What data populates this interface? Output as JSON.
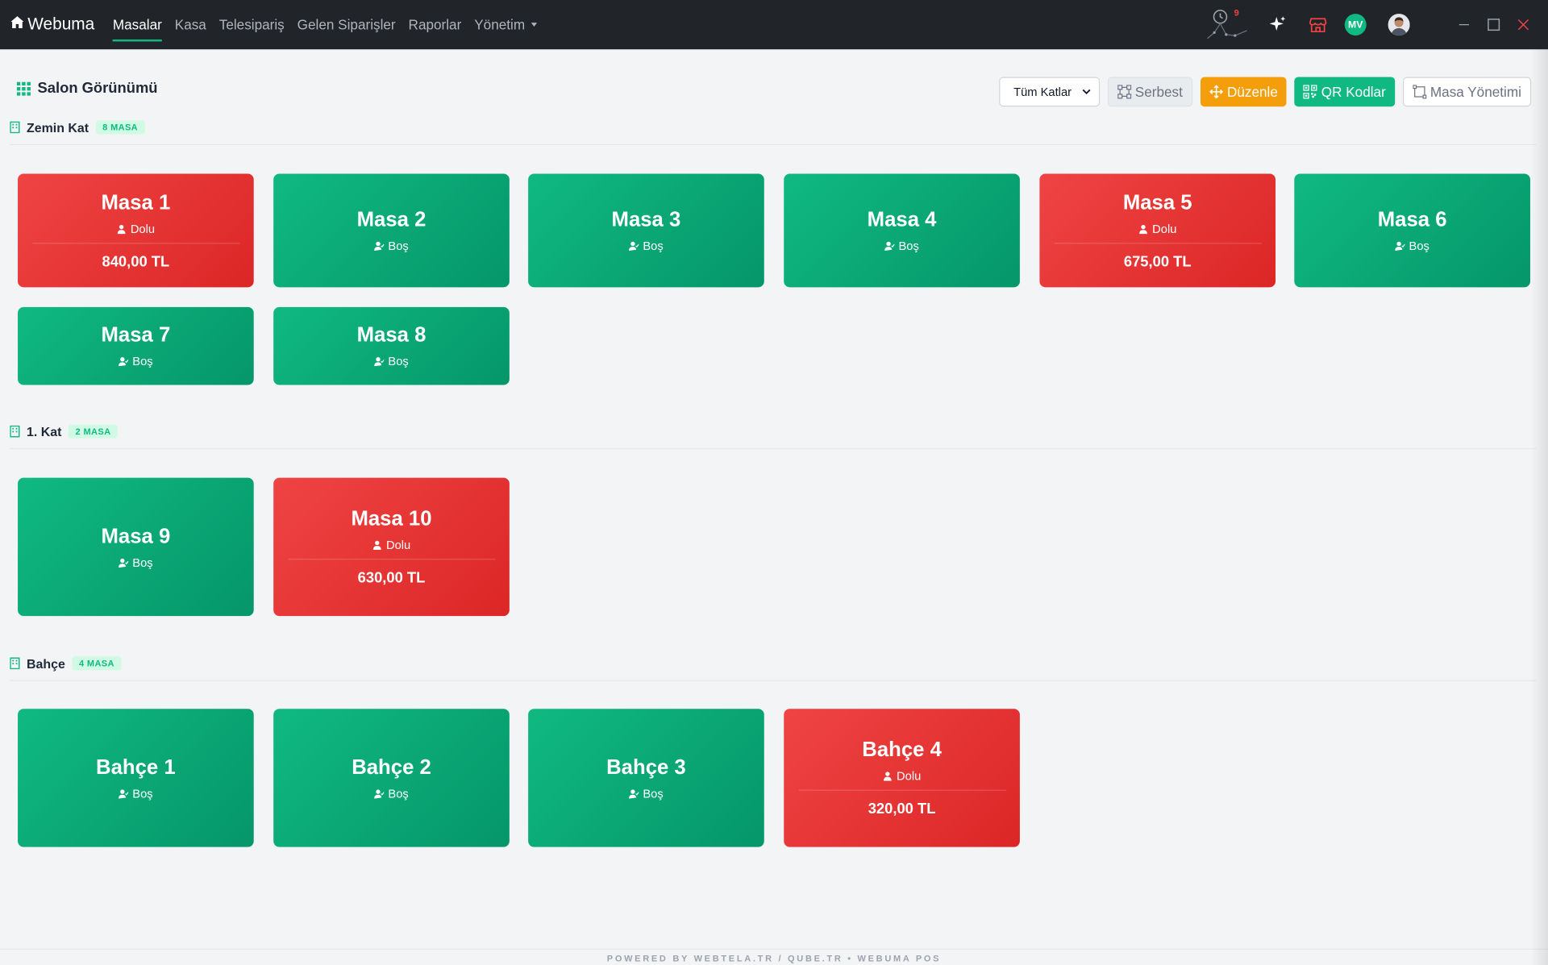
{
  "app": {
    "brand": "Webuma"
  },
  "nav": [
    {
      "label": "Masalar",
      "active": true
    },
    {
      "label": "Kasa"
    },
    {
      "label": "Telesipariş"
    },
    {
      "label": "Gelen Siparişler"
    },
    {
      "label": "Raporlar"
    },
    {
      "label": "Yönetim"
    }
  ],
  "topbar": {
    "clock_badge": "9",
    "avatar_initials": "MV"
  },
  "toolbar": {
    "title": "Salon Görünümü",
    "floor_select": "Tüm Katlar",
    "serbest": "Serbest",
    "duzenle": "Düzenle",
    "qr": "QR Kodlar",
    "masa_yonetimi": "Masa Yönetimi"
  },
  "sections": [
    {
      "name": "Zemin Kat",
      "count": "8 MASA",
      "tables": [
        {
          "name": "Masa 1",
          "status": "Dolu",
          "total": "840,00 TL"
        },
        {
          "name": "Masa 2",
          "status": "Boş"
        },
        {
          "name": "Masa 3",
          "status": "Boş"
        },
        {
          "name": "Masa 4",
          "status": "Boş"
        },
        {
          "name": "Masa 5",
          "status": "Dolu",
          "total": "675,00 TL"
        },
        {
          "name": "Masa 6",
          "status": "Boş"
        },
        {
          "name": "Masa 7",
          "status": "Boş"
        },
        {
          "name": "Masa 8",
          "status": "Boş"
        }
      ]
    },
    {
      "name": "1. Kat",
      "count": "2 MASA",
      "tables": [
        {
          "name": "Masa 9",
          "status": "Boş"
        },
        {
          "name": "Masa 10",
          "status": "Dolu",
          "total": "630,00 TL"
        }
      ]
    },
    {
      "name": "Bahçe",
      "count": "4 MASA",
      "tables": [
        {
          "name": "Bahçe 1",
          "status": "Boş"
        },
        {
          "name": "Bahçe 2",
          "status": "Boş"
        },
        {
          "name": "Bahçe 3",
          "status": "Boş"
        },
        {
          "name": "Bahçe 4",
          "status": "Dolu",
          "total": "320,00 TL"
        }
      ]
    }
  ],
  "footer": "POWERED BY WEBTELA.TR / QUBE.TR • WEBUMA POS",
  "colors": {
    "free": "#10b981",
    "occupied": "#ef4444",
    "accent": "#f59e0b"
  }
}
